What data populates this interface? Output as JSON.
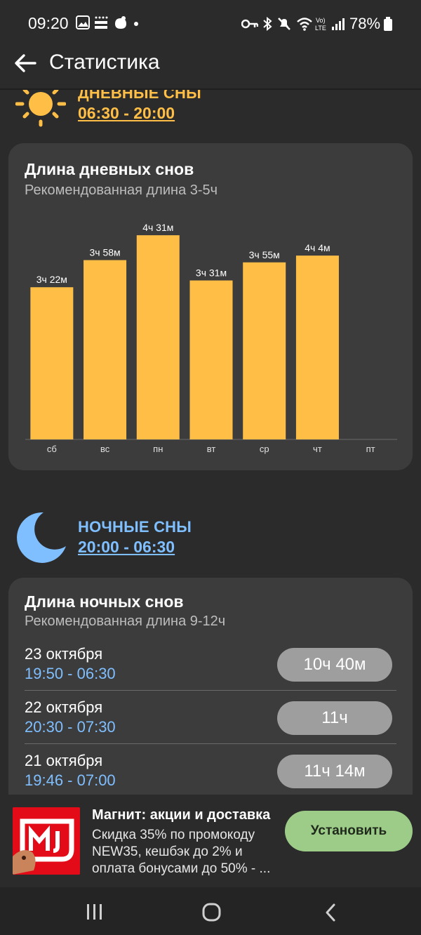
{
  "status_bar": {
    "time": "09:20",
    "battery": "78%"
  },
  "app_bar": {
    "title": "Статистика",
    "back_icon": "arrow-left-icon"
  },
  "day_section": {
    "title": "ДНЕВНЫЕ СНЫ",
    "range": "06:30 - 20:00",
    "icon": "sun-icon",
    "color": "#ffbf47"
  },
  "day_card": {
    "title": "Длина дневных снов",
    "subtitle": "Рекомендованная длина 3-5ч"
  },
  "chart_data": {
    "type": "bar",
    "categories": [
      "сб",
      "вс",
      "пн",
      "вт",
      "ср",
      "чт",
      "пт"
    ],
    "values_minutes": [
      202,
      238,
      271,
      211,
      235,
      244,
      null
    ],
    "data_labels": [
      "3ч 22м",
      "3ч 58м",
      "4ч 31м",
      "3ч 31м",
      "3ч 55м",
      "4ч 4м",
      ""
    ],
    "bar_color": "#ffbf47",
    "ylim": [
      0,
      300
    ],
    "grid": false
  },
  "night_section": {
    "title": "НОЧНЫЕ СНЫ",
    "range": "20:00 - 06:30",
    "icon": "moon-icon",
    "color": "#7fbfff"
  },
  "night_card": {
    "title": "Длина ночных снов",
    "subtitle": "Рекомендованная длина 9-12ч",
    "rows": [
      {
        "date": "23 октября",
        "range": "19:50 - 06:30",
        "duration": "10ч 40м"
      },
      {
        "date": "22 октября",
        "range": "20:30 - 07:30",
        "duration": "11ч"
      },
      {
        "date": "21 октября",
        "range": "19:46 - 07:00",
        "duration": "11ч 14м"
      }
    ]
  },
  "ad": {
    "title": "Магнит: акции и доставка",
    "body": "Скидка 35% по промокоду NEW35, кешбэк до 2% и оплата бонусами до 50% - ...",
    "button": "Установить",
    "logo_text": "М"
  },
  "nav_bar": {
    "recents_icon": "recents-icon",
    "home_icon": "home-icon",
    "back_icon": "back-chevron-icon"
  }
}
